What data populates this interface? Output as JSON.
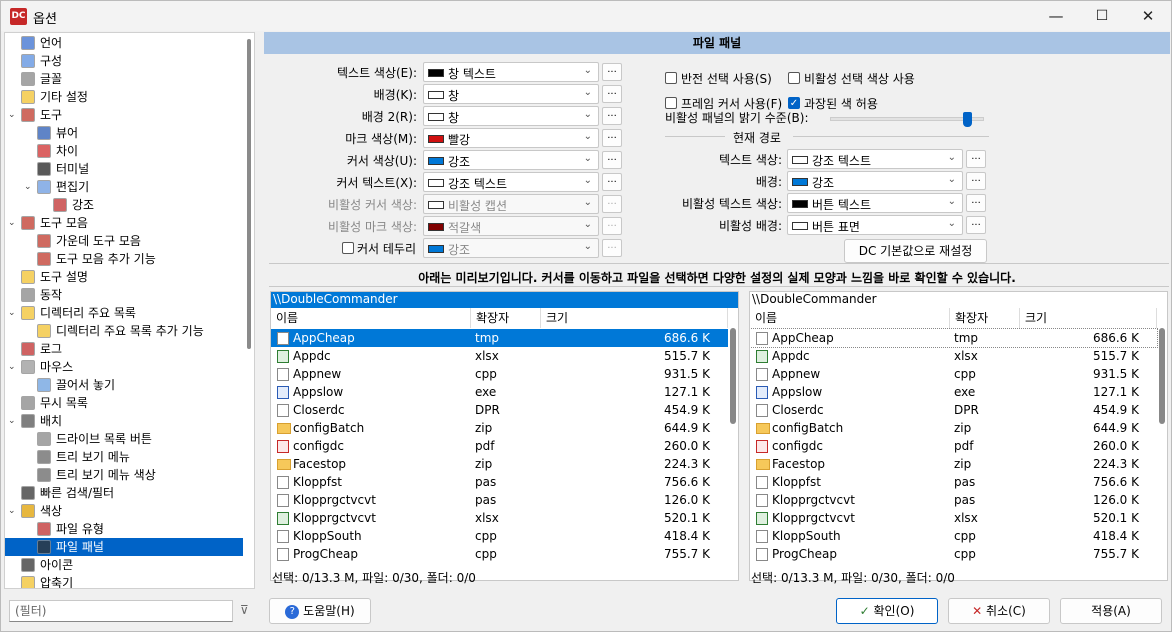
{
  "window": {
    "title": "옵션",
    "minimize": "—",
    "maximize": "☐",
    "close": "✕"
  },
  "tree": [
    {
      "label": "언어",
      "indent": 0,
      "exp": ""
    },
    {
      "label": "구성",
      "indent": 0,
      "exp": ""
    },
    {
      "label": "글꼴",
      "indent": 0,
      "exp": ""
    },
    {
      "label": "기타 설정",
      "indent": 0,
      "exp": ""
    },
    {
      "label": "도구",
      "indent": 0,
      "exp": "v"
    },
    {
      "label": "뷰어",
      "indent": 1,
      "exp": ""
    },
    {
      "label": "차이",
      "indent": 1,
      "exp": ""
    },
    {
      "label": "터미널",
      "indent": 1,
      "exp": ""
    },
    {
      "label": "편집기",
      "indent": 1,
      "exp": "v"
    },
    {
      "label": "강조",
      "indent": 2,
      "exp": ""
    },
    {
      "label": "도구 모음",
      "indent": 0,
      "exp": "v"
    },
    {
      "label": "가운데 도구 모음",
      "indent": 1,
      "exp": ""
    },
    {
      "label": "도구 모음 추가 기능",
      "indent": 1,
      "exp": ""
    },
    {
      "label": "도구 설명",
      "indent": 0,
      "exp": ""
    },
    {
      "label": "동작",
      "indent": 0,
      "exp": ""
    },
    {
      "label": "디렉터리 주요 목록",
      "indent": 0,
      "exp": "v"
    },
    {
      "label": "디렉터리 주요 목록 추가 기능",
      "indent": 1,
      "exp": ""
    },
    {
      "label": "로그",
      "indent": 0,
      "exp": ""
    },
    {
      "label": "마우스",
      "indent": 0,
      "exp": "v"
    },
    {
      "label": "끌어서 놓기",
      "indent": 1,
      "exp": ""
    },
    {
      "label": "무시 목록",
      "indent": 0,
      "exp": ""
    },
    {
      "label": "배치",
      "indent": 0,
      "exp": "v"
    },
    {
      "label": "드라이브 목록 버튼",
      "indent": 1,
      "exp": ""
    },
    {
      "label": "트리 보기 메뉴",
      "indent": 1,
      "exp": ""
    },
    {
      "label": "트리 보기 메뉴 색상",
      "indent": 1,
      "exp": ""
    },
    {
      "label": "빠른 검색/필터",
      "indent": 0,
      "exp": ""
    },
    {
      "label": "색상",
      "indent": 0,
      "exp": "v"
    },
    {
      "label": "파일 유형",
      "indent": 1,
      "exp": ""
    },
    {
      "label": "파일 패널",
      "indent": 1,
      "exp": "",
      "selected": true
    },
    {
      "label": "아이콘",
      "indent": 0,
      "exp": ""
    },
    {
      "label": "압축기",
      "indent": 0,
      "exp": ""
    }
  ],
  "filter": {
    "placeholder": "(필터)"
  },
  "panel_title": "파일 패널",
  "left_colors": [
    {
      "label": "텍스트 색상(E):",
      "value": "창 텍스트",
      "swatch": "#000000",
      "disabled": false
    },
    {
      "label": "배경(K):",
      "value": "창",
      "swatch": "#ffffff",
      "disabled": false
    },
    {
      "label": "배경 2(R):",
      "value": "창",
      "swatch": "#ffffff",
      "disabled": false
    },
    {
      "label": "마크 색상(M):",
      "value": "빨강",
      "swatch": "#d01010",
      "disabled": false
    },
    {
      "label": "커서 색상(U):",
      "value": "강조",
      "swatch": "#0078d7",
      "disabled": false
    },
    {
      "label": "커서 텍스트(X):",
      "value": "강조 텍스트",
      "swatch": "#ffffff",
      "disabled": false
    },
    {
      "label": "비활성 커서 색상:",
      "value": "비활성 캡션",
      "swatch": "#ffffff",
      "disabled": true
    },
    {
      "label": "비활성 마크 색상:",
      "value": "적갈색",
      "swatch": "#800000",
      "disabled": true
    },
    {
      "label": "커서 테두리",
      "value": "강조",
      "swatch": "#0078d7",
      "disabled": true
    }
  ],
  "checks": {
    "inverse_sel": {
      "label": "반전 선택 사용(S)",
      "checked": false
    },
    "inactive_sel": {
      "label": "비활성 선택 색상 사용",
      "checked": false
    },
    "frame_cursor": {
      "label": "프레임 커서 사용(F)",
      "checked": false
    },
    "extended": {
      "label": "과장된 색 허용",
      "checked": true
    }
  },
  "brightness": {
    "label": "비활성 패널의 밝기 수준(B):",
    "value": 0.92
  },
  "current_path": {
    "title": "현재 경로",
    "rows": [
      {
        "label": "텍스트 색상:",
        "value": "강조 텍스트",
        "swatch": "#ffffff"
      },
      {
        "label": "배경:",
        "value": "강조",
        "swatch": "#0078d7"
      },
      {
        "label": "비활성 텍스트 색상:",
        "value": "버튼 텍스트",
        "swatch": "#000000"
      },
      {
        "label": "비활성 배경:",
        "value": "버튼 표면",
        "swatch": "#ffffff"
      }
    ],
    "reset_button": "DC 기본값으로 재설정"
  },
  "dots": "...",
  "preview_title": "아래는 미리보기입니다. 커서를 이동하고 파일을 선택하면 다양한 설정의 실제 모양과 느낌을 바로 확인할 수 있습니다.",
  "preview": {
    "path": "\\\\DoubleCommander",
    "columns": [
      "이름",
      "확장자",
      "크기"
    ],
    "files": [
      {
        "name": "AppCheap",
        "ext": "tmp",
        "size": "686.6 K",
        "icon": "file"
      },
      {
        "name": "Appdc",
        "ext": "xlsx",
        "size": "515.7 K",
        "icon": "xls"
      },
      {
        "name": "Appnew",
        "ext": "cpp",
        "size": "931.5 K",
        "icon": "file"
      },
      {
        "name": "Appslow",
        "ext": "exe",
        "size": "127.1 K",
        "icon": "exe"
      },
      {
        "name": "Closerdc",
        "ext": "DPR",
        "size": "454.9 K",
        "icon": "file"
      },
      {
        "name": "configBatch",
        "ext": "zip",
        "size": "644.9 K",
        "icon": "folder"
      },
      {
        "name": "configdc",
        "ext": "pdf",
        "size": "260.0 K",
        "icon": "pdf"
      },
      {
        "name": "Facestop",
        "ext": "zip",
        "size": "224.3 K",
        "icon": "folder"
      },
      {
        "name": "Kloppfst",
        "ext": "pas",
        "size": "756.6 K",
        "icon": "file"
      },
      {
        "name": "Klopprgctvcvt",
        "ext": "pas",
        "size": "126.0 K",
        "icon": "file"
      },
      {
        "name": "Klopprgctvcvt",
        "ext": "xlsx",
        "size": "520.1 K",
        "icon": "xls"
      },
      {
        "name": "KloppSouth",
        "ext": "cpp",
        "size": "418.4 K",
        "icon": "file"
      },
      {
        "name": "ProgCheap",
        "ext": "cpp",
        "size": "755.7 K",
        "icon": "file"
      }
    ],
    "status": "선택: 0/13.3 M, 파일: 0/30, 폴더: 0/0"
  },
  "buttons": {
    "help": "도움말(H)",
    "ok": "확인(O)",
    "cancel": "취소(C)",
    "apply": "적용(A)"
  }
}
